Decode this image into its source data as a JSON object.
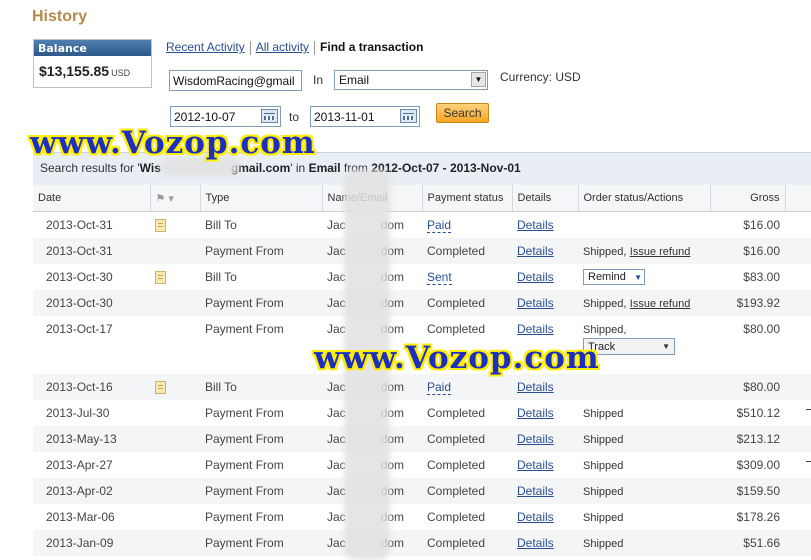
{
  "page_title": "History",
  "balance": {
    "header": "Balance",
    "amount": "$13,155.85",
    "currency": "USD"
  },
  "tabs": {
    "recent": "Recent Activity",
    "all": "All activity",
    "find": "Find a transaction"
  },
  "search": {
    "query": "WisdomRacing@gmail",
    "in_label": "In",
    "in_value": "Email",
    "currency_label": "Currency: USD",
    "date_from": "2012-10-07",
    "to_label": "to",
    "date_to": "2013-11-01",
    "button": "Search"
  },
  "results_header": {
    "prefix": "Search results for '",
    "query_start": "Wis",
    "query_end": "gmail.com",
    "middle": "' in ",
    "field": "Email",
    "from_word": " from ",
    "range": "2012-Oct-07 - 2013-Nov-01"
  },
  "watermark": "www.Vozop.com",
  "columns": [
    "Date",
    "",
    "Type",
    "Name/Email",
    "Payment status",
    "Details",
    "Order status/Actions",
    "Gross"
  ],
  "rows": [
    {
      "date": "2013-Oct-31",
      "note": true,
      "type": "Bill To",
      "name_a": "Jac",
      "name_b": "dom",
      "status": "Paid",
      "status_style": "dash",
      "details": "Details",
      "order": "",
      "action": "",
      "gross": "$16.00"
    },
    {
      "date": "2013-Oct-31",
      "note": false,
      "type": "Payment From",
      "name_a": "Jac",
      "name_b": "dom",
      "status": "Completed",
      "status_style": "plain",
      "details": "Details",
      "order": "Shipped,",
      "action": "Issue refund",
      "gross": "$16.00"
    },
    {
      "date": "2013-Oct-30",
      "note": true,
      "type": "Bill To",
      "name_a": "Jac",
      "name_b": "dom",
      "status": "Sent",
      "status_style": "dash",
      "details": "Details",
      "order": "",
      "action": "Remind",
      "gross": "$83.00"
    },
    {
      "date": "2013-Oct-30",
      "note": false,
      "type": "Payment From",
      "name_a": "Jac",
      "name_b": "dom",
      "status": "Completed",
      "status_style": "plain",
      "details": "Details",
      "order": "Shipped,",
      "action": "Issue refund",
      "gross": "$193.92"
    },
    {
      "date": "2013-Oct-17",
      "note": false,
      "type": "Payment From",
      "name_a": "Jac",
      "name_b": "dom",
      "status": "Completed",
      "status_style": "plain",
      "details": "Details",
      "order": "Shipped,",
      "action": "Track",
      "gross": "$80.00"
    },
    {
      "date": "2013-Oct-16",
      "note": true,
      "type": "Bill To",
      "name_a": "Jac",
      "name_b": "dom",
      "status": "Paid",
      "status_style": "dash",
      "details": "Details",
      "order": "",
      "action": "",
      "gross": "$80.00"
    },
    {
      "date": "2013-Jul-30",
      "note": false,
      "type": "Payment From",
      "name_a": "Jac",
      "name_b": "dom",
      "status": "Completed",
      "status_style": "plain",
      "details": "Details",
      "order": "Shipped",
      "action": "",
      "gross": "$510.12"
    },
    {
      "date": "2013-May-13",
      "note": false,
      "type": "Payment From",
      "name_a": "Jac",
      "name_b": "dom",
      "status": "Completed",
      "status_style": "plain",
      "details": "Details",
      "order": "Shipped",
      "action": "",
      "gross": "$213.12"
    },
    {
      "date": "2013-Apr-27",
      "note": false,
      "type": "Payment From",
      "name_a": "Jac",
      "name_b": "dom",
      "status": "Completed",
      "status_style": "plain",
      "details": "Details",
      "order": "Shipped",
      "action": "",
      "gross": "$309.00"
    },
    {
      "date": "2013-Apr-02",
      "note": false,
      "type": "Payment From",
      "name_a": "Jac",
      "name_b": "dom",
      "status": "Completed",
      "status_style": "plain",
      "details": "Details",
      "order": "Shipped",
      "action": "",
      "gross": "$159.50"
    },
    {
      "date": "2013-Mar-06",
      "note": false,
      "type": "Payment From",
      "name_a": "Jac",
      "name_b": "dom",
      "status": "Completed",
      "status_style": "plain",
      "details": "Details",
      "order": "Shipped",
      "action": "",
      "gross": "$178.26"
    },
    {
      "date": "2013-Jan-09",
      "note": false,
      "type": "Payment From",
      "name_a": "Jac",
      "name_b": "dom",
      "status": "Completed",
      "status_style": "plain",
      "details": "Details",
      "order": "Shipped",
      "action": "",
      "gross": "$51.66"
    }
  ]
}
